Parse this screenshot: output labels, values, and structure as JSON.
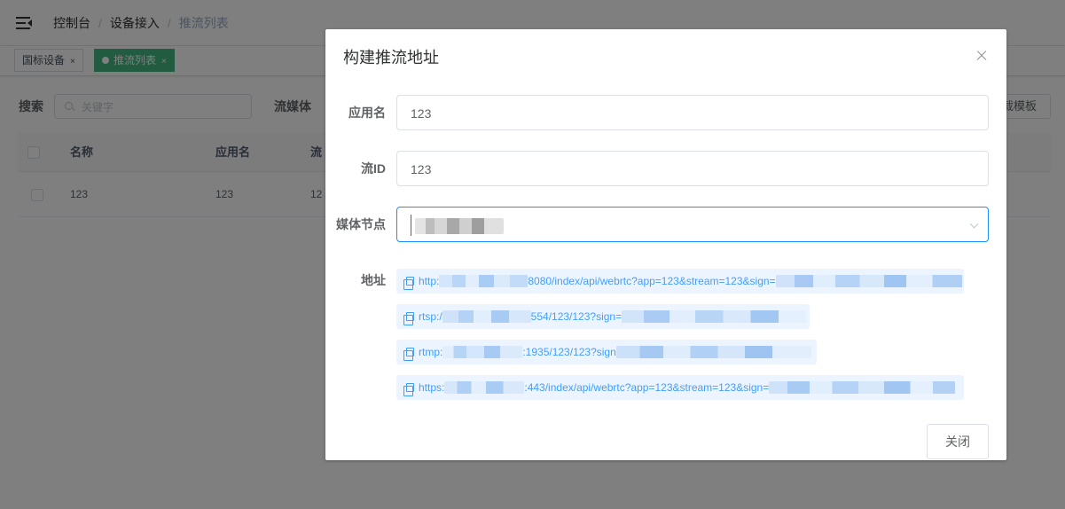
{
  "breadcrumb": [
    "控制台",
    "设备接入",
    "推流列表"
  ],
  "tags": [
    {
      "label": "国标设备",
      "close": "×"
    },
    {
      "label": "推流列表",
      "close": "×"
    }
  ],
  "search": {
    "label": "搜索",
    "placeholder": "关键字",
    "media_label": "流媒体",
    "template_button": "载模板"
  },
  "table": {
    "headers": [
      "名称",
      "应用名",
      "流"
    ],
    "rows": [
      {
        "name": "123",
        "app": "123",
        "stream": "12"
      }
    ]
  },
  "dialog": {
    "title": "构建推流地址",
    "close_icon": "close-icon",
    "fields": {
      "app_label": "应用名",
      "app_value": "123",
      "stream_label": "流ID",
      "stream_value": "123",
      "node_label": "媒体节点",
      "address_label": "地址"
    },
    "urls": [
      {
        "prefix": "http:",
        "suffix": "8080/index/api/webrtc?app=123&stream=123&sign="
      },
      {
        "prefix": "rtsp:/",
        "suffix": "554/123/123?sign="
      },
      {
        "prefix": "rtmp:",
        "suffix": ":1935/123/123?sign"
      },
      {
        "prefix": "https:",
        "suffix": ":443/index/api/webrtc?app=123&stream=123&sign="
      }
    ],
    "close_button": "关闭"
  },
  "colors": {
    "accent": "#409eff",
    "active_tag": "#42b983",
    "link_bg": "#ecf5ff"
  }
}
